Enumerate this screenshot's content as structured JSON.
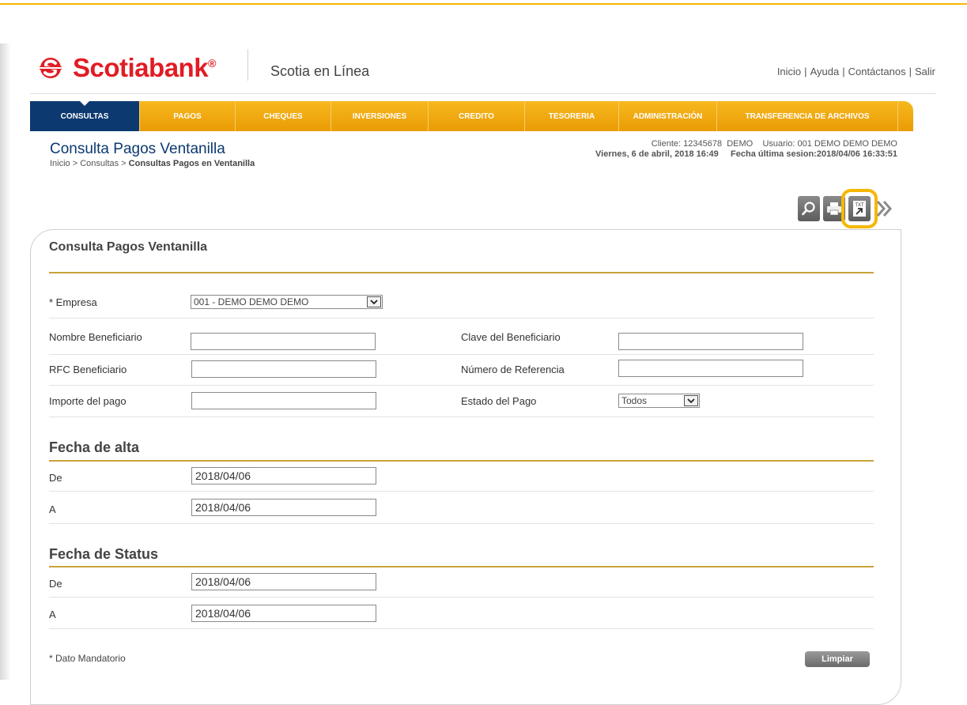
{
  "header": {
    "brand": "Scotiabank",
    "brand_mark": "®",
    "app_name": "Scotia en Línea",
    "links": [
      "Inicio",
      "Ayuda",
      "Contáctanos",
      "Salir"
    ],
    "link_sep": "|"
  },
  "nav": {
    "active": "CONSULTAS",
    "items": [
      "CONSULTAS",
      "PAGOS",
      "CHEQUES",
      "INVERSIONES",
      "CREDITO",
      "TESORERIA",
      "ADMINISTRACIÓN",
      "TRANSFERENCIA DE ARCHIVOS"
    ]
  },
  "page": {
    "title": "Consulta Pagos Ventanilla",
    "breadcrumb_prefix": "Inicio > Consultas > ",
    "breadcrumb_current": "Consultas Pagos en Ventanilla"
  },
  "session": {
    "cliente_label": "Cliente:",
    "cliente_value": "12345678",
    "cliente_name": "DEMO",
    "usuario_label": "Usuario:",
    "usuario_value": "001 DEMO DEMO DEMO",
    "date": "Viernes, 6 de abril, 2018 16:49",
    "last_session_label": "Fecha última sesion:",
    "last_session_value": "2018/04/06 16:33:51"
  },
  "toolbar": {
    "icons": [
      "search-icon",
      "print-icon",
      "txt-export-icon",
      "next-icon"
    ],
    "txt_label": "TXT",
    "highlight_color": "#f5b700"
  },
  "form": {
    "title": "Consulta Pagos Ventanilla",
    "empresa_label": "* Empresa",
    "empresa_value": "001 - DEMO DEMO DEMO",
    "nombre_label": "Nombre Beneficiario",
    "nombre_value": "",
    "clave_label": "Clave del Beneficiario",
    "clave_value": "",
    "rfc_label": "RFC Beneficiario",
    "rfc_value": "",
    "referencia_label": "Número de Referencia",
    "referencia_value": "",
    "importe_label": "Importe del pago",
    "importe_value": "",
    "estado_label": "Estado del Pago",
    "estado_value": "Todos"
  },
  "fecha_alta": {
    "title": "Fecha de alta",
    "de_label": "De",
    "de_value": "2018/04/06",
    "a_label": "A",
    "a_value": "2018/04/06"
  },
  "fecha_status": {
    "title": "Fecha de Status",
    "de_label": "De",
    "de_value": "2018/04/06",
    "a_label": "A",
    "a_value": "2018/04/06"
  },
  "footer": {
    "mandatory_note": "* Dato Mandatorio",
    "clear_button": "Limpiar"
  },
  "colors": {
    "brand_red": "#e11c24",
    "nav_orange": "#f0a812",
    "nav_active": "#0c3970",
    "accent_gold": "#c9a23a"
  }
}
